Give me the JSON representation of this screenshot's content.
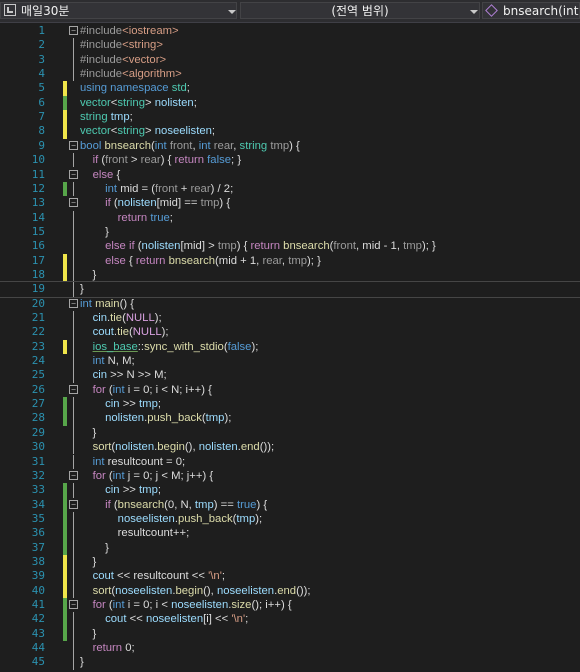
{
  "navbar": {
    "project": "매일30분",
    "scope": "(전역 범위)",
    "member": "bnsearch(int front, int rear, string tmp)"
  },
  "colors": {
    "change_saved": "#57a64a",
    "change_unsaved": "#efe54a"
  },
  "code": {
    "lines": [
      {
        "n": "1",
        "fold": "minus",
        "chg": "",
        "tokens": [
          [
            "p",
            "#include"
          ],
          [
            "s",
            "<iostream>"
          ]
        ]
      },
      {
        "n": "2",
        "fold": "bar",
        "chg": "",
        "tokens": [
          [
            "p",
            "#include"
          ],
          [
            "s",
            "<string>"
          ]
        ]
      },
      {
        "n": "3",
        "fold": "bar",
        "chg": "",
        "tokens": [
          [
            "p",
            "#include"
          ],
          [
            "s",
            "<vector>"
          ]
        ]
      },
      {
        "n": "4",
        "fold": "bar",
        "chg": "",
        "tokens": [
          [
            "p",
            "#include"
          ],
          [
            "s",
            "<algorithm>"
          ]
        ]
      },
      {
        "n": "5",
        "fold": "",
        "chg": "y",
        "tokens": [
          [
            "k",
            "using "
          ],
          [
            "k",
            "namespace "
          ],
          [
            "t",
            "std"
          ],
          [
            "w",
            ";"
          ]
        ]
      },
      {
        "n": "6",
        "fold": "",
        "chg": "g",
        "tokens": [
          [
            "t",
            "vector"
          ],
          [
            "w",
            "<"
          ],
          [
            "t",
            "string"
          ],
          [
            "w",
            "> "
          ],
          [
            "v",
            "nolisten"
          ],
          [
            "w",
            ";"
          ]
        ]
      },
      {
        "n": "7",
        "fold": "",
        "chg": "y",
        "tokens": [
          [
            "t",
            "string "
          ],
          [
            "v",
            "tmp"
          ],
          [
            "w",
            ";"
          ]
        ]
      },
      {
        "n": "8",
        "fold": "",
        "chg": "y",
        "tokens": [
          [
            "t",
            "vector"
          ],
          [
            "w",
            "<"
          ],
          [
            "t",
            "string"
          ],
          [
            "w",
            "> "
          ],
          [
            "v",
            "noseelisten"
          ],
          [
            "w",
            ";"
          ]
        ]
      },
      {
        "n": "9",
        "fold": "minus",
        "chg": "",
        "tokens": [
          [
            "k",
            "bool "
          ],
          [
            "f",
            "bnsearch"
          ],
          [
            "w",
            "("
          ],
          [
            "k",
            "int "
          ],
          [
            "p",
            "front"
          ],
          [
            "w",
            ", "
          ],
          [
            "k",
            "int "
          ],
          [
            "p",
            "rear"
          ],
          [
            "w",
            ", "
          ],
          [
            "t",
            "string "
          ],
          [
            "p",
            "tmp"
          ],
          [
            "w",
            ") {"
          ]
        ]
      },
      {
        "n": "10",
        "fold": "bar",
        "chg": "",
        "tokens": [
          [
            "w",
            "    "
          ],
          [
            "c",
            "if "
          ],
          [
            "w",
            "("
          ],
          [
            "p",
            "front"
          ],
          [
            "w",
            " > "
          ],
          [
            "p",
            "rear"
          ],
          [
            "w",
            ") { "
          ],
          [
            "c",
            "return "
          ],
          [
            "k",
            "false"
          ],
          [
            "w",
            "; }"
          ]
        ]
      },
      {
        "n": "11",
        "fold": "minus",
        "chg": "",
        "tokens": [
          [
            "w",
            "    "
          ],
          [
            "c",
            "else "
          ],
          [
            "w",
            "{"
          ]
        ]
      },
      {
        "n": "12",
        "fold": "bar",
        "chg": "g",
        "tokens": [
          [
            "w",
            "        "
          ],
          [
            "k",
            "int "
          ],
          [
            "w",
            "mid = ("
          ],
          [
            "p",
            "front"
          ],
          [
            "w",
            " + "
          ],
          [
            "p",
            "rear"
          ],
          [
            "w",
            ") / 2;"
          ]
        ]
      },
      {
        "n": "13",
        "fold": "minus",
        "chg": "",
        "tokens": [
          [
            "w",
            "        "
          ],
          [
            "c",
            "if "
          ],
          [
            "w",
            "("
          ],
          [
            "v",
            "nolisten"
          ],
          [
            "w",
            "[mid] == "
          ],
          [
            "p",
            "tmp"
          ],
          [
            "w",
            ") {"
          ]
        ]
      },
      {
        "n": "14",
        "fold": "bar",
        "chg": "",
        "tokens": [
          [
            "w",
            "            "
          ],
          [
            "c",
            "return "
          ],
          [
            "k",
            "true"
          ],
          [
            "w",
            ";"
          ]
        ]
      },
      {
        "n": "15",
        "fold": "bar",
        "chg": "",
        "tokens": [
          [
            "w",
            "        }"
          ]
        ]
      },
      {
        "n": "16",
        "fold": "bar",
        "chg": "",
        "tokens": [
          [
            "w",
            "        "
          ],
          [
            "c",
            "else if "
          ],
          [
            "w",
            "("
          ],
          [
            "v",
            "nolisten"
          ],
          [
            "w",
            "[mid] > "
          ],
          [
            "p",
            "tmp"
          ],
          [
            "w",
            ") { "
          ],
          [
            "c",
            "return "
          ],
          [
            "f",
            "bnsearch"
          ],
          [
            "w",
            "("
          ],
          [
            "p",
            "front"
          ],
          [
            "w",
            ", mid - 1, "
          ],
          [
            "p",
            "tmp"
          ],
          [
            "w",
            "); }"
          ]
        ]
      },
      {
        "n": "17",
        "fold": "bar",
        "chg": "y",
        "tokens": [
          [
            "w",
            "        "
          ],
          [
            "c",
            "else "
          ],
          [
            "w",
            "{ "
          ],
          [
            "c",
            "return "
          ],
          [
            "f",
            "bnsearch"
          ],
          [
            "w",
            "(mid + 1, "
          ],
          [
            "p",
            "rear"
          ],
          [
            "w",
            ", "
          ],
          [
            "p",
            "tmp"
          ],
          [
            "w",
            "); }"
          ]
        ]
      },
      {
        "n": "18",
        "fold": "bar",
        "chg": "y",
        "tokens": [
          [
            "w",
            "    }"
          ]
        ]
      },
      {
        "n": "19",
        "fold": "bar",
        "chg": "",
        "cursor": true,
        "tokens": [
          [
            "w",
            "}"
          ]
        ]
      },
      {
        "n": "20",
        "fold": "minus",
        "chg": "",
        "tokens": [
          [
            "k",
            "int "
          ],
          [
            "f",
            "main"
          ],
          [
            "w",
            "() {"
          ]
        ]
      },
      {
        "n": "21",
        "fold": "bar",
        "chg": "",
        "tokens": [
          [
            "w",
            "    "
          ],
          [
            "v",
            "cin"
          ],
          [
            "w",
            "."
          ],
          [
            "f",
            "tie"
          ],
          [
            "w",
            "("
          ],
          [
            "r",
            "NULL"
          ],
          [
            "w",
            ");"
          ]
        ]
      },
      {
        "n": "22",
        "fold": "bar",
        "chg": "",
        "tokens": [
          [
            "w",
            "    "
          ],
          [
            "v",
            "cout"
          ],
          [
            "w",
            "."
          ],
          [
            "f",
            "tie"
          ],
          [
            "w",
            "("
          ],
          [
            "r",
            "NULL"
          ],
          [
            "w",
            ");"
          ]
        ]
      },
      {
        "n": "23",
        "fold": "bar",
        "chg": "y",
        "tokens": [
          [
            "w",
            "    "
          ],
          [
            "g",
            "ios_base"
          ],
          [
            "w",
            "::"
          ],
          [
            "f",
            "sync_with_stdio"
          ],
          [
            "w",
            "("
          ],
          [
            "k",
            "false"
          ],
          [
            "w",
            ");"
          ]
        ]
      },
      {
        "n": "24",
        "fold": "bar",
        "chg": "",
        "tokens": [
          [
            "w",
            "    "
          ],
          [
            "k",
            "int "
          ],
          [
            "w",
            "N, M;"
          ]
        ]
      },
      {
        "n": "25",
        "fold": "bar",
        "chg": "",
        "tokens": [
          [
            "w",
            "    "
          ],
          [
            "v",
            "cin"
          ],
          [
            "w",
            " >> N >> M;"
          ]
        ]
      },
      {
        "n": "26",
        "fold": "minus",
        "chg": "",
        "tokens": [
          [
            "w",
            "    "
          ],
          [
            "c",
            "for "
          ],
          [
            "w",
            "("
          ],
          [
            "k",
            "int "
          ],
          [
            "w",
            "i = 0; i < N; i++) {"
          ]
        ]
      },
      {
        "n": "27",
        "fold": "bar",
        "chg": "g",
        "tokens": [
          [
            "w",
            "        "
          ],
          [
            "v",
            "cin"
          ],
          [
            "w",
            " >> "
          ],
          [
            "v",
            "tmp"
          ],
          [
            "w",
            ";"
          ]
        ]
      },
      {
        "n": "28",
        "fold": "bar",
        "chg": "g",
        "tokens": [
          [
            "w",
            "        "
          ],
          [
            "v",
            "nolisten"
          ],
          [
            "w",
            "."
          ],
          [
            "f",
            "push_back"
          ],
          [
            "w",
            "("
          ],
          [
            "v",
            "tmp"
          ],
          [
            "w",
            ");"
          ]
        ]
      },
      {
        "n": "29",
        "fold": "bar",
        "chg": "",
        "tokens": [
          [
            "w",
            "    }"
          ]
        ]
      },
      {
        "n": "30",
        "fold": "bar",
        "chg": "",
        "tokens": [
          [
            "w",
            "    "
          ],
          [
            "f",
            "sort"
          ],
          [
            "w",
            "("
          ],
          [
            "v",
            "nolisten"
          ],
          [
            "w",
            "."
          ],
          [
            "f",
            "begin"
          ],
          [
            "w",
            "(), "
          ],
          [
            "v",
            "nolisten"
          ],
          [
            "w",
            "."
          ],
          [
            "f",
            "end"
          ],
          [
            "w",
            "());"
          ]
        ]
      },
      {
        "n": "31",
        "fold": "bar",
        "chg": "",
        "tokens": [
          [
            "w",
            "    "
          ],
          [
            "k",
            "int "
          ],
          [
            "w",
            "resultcount = 0;"
          ]
        ]
      },
      {
        "n": "32",
        "fold": "minus",
        "chg": "",
        "tokens": [
          [
            "w",
            "    "
          ],
          [
            "c",
            "for "
          ],
          [
            "w",
            "("
          ],
          [
            "k",
            "int "
          ],
          [
            "w",
            "j = 0; j < M; j++) {"
          ]
        ]
      },
      {
        "n": "33",
        "fold": "bar",
        "chg": "g",
        "tokens": [
          [
            "w",
            "        "
          ],
          [
            "v",
            "cin"
          ],
          [
            "w",
            " >> "
          ],
          [
            "v",
            "tmp"
          ],
          [
            "w",
            ";"
          ]
        ]
      },
      {
        "n": "34",
        "fold": "minus",
        "chg": "g",
        "tokens": [
          [
            "w",
            "        "
          ],
          [
            "c",
            "if "
          ],
          [
            "w",
            "("
          ],
          [
            "f",
            "bnsearch"
          ],
          [
            "w",
            "(0, N, "
          ],
          [
            "v",
            "tmp"
          ],
          [
            "w",
            ") == "
          ],
          [
            "k",
            "true"
          ],
          [
            "w",
            ") {"
          ]
        ]
      },
      {
        "n": "35",
        "fold": "bar",
        "chg": "g",
        "tokens": [
          [
            "w",
            "            "
          ],
          [
            "v",
            "noseelisten"
          ],
          [
            "w",
            "."
          ],
          [
            "f",
            "push_back"
          ],
          [
            "w",
            "("
          ],
          [
            "v",
            "tmp"
          ],
          [
            "w",
            ");"
          ]
        ]
      },
      {
        "n": "36",
        "fold": "bar",
        "chg": "g",
        "tokens": [
          [
            "w",
            "            resultcount++;"
          ]
        ]
      },
      {
        "n": "37",
        "fold": "bar",
        "chg": "g",
        "tokens": [
          [
            "w",
            "        }"
          ]
        ]
      },
      {
        "n": "38",
        "fold": "bar",
        "chg": "y",
        "tokens": [
          [
            "w",
            "    }"
          ]
        ]
      },
      {
        "n": "39",
        "fold": "bar",
        "chg": "y",
        "tokens": [
          [
            "w",
            "    "
          ],
          [
            "v",
            "cout"
          ],
          [
            "w",
            " << resultcount << "
          ],
          [
            "s",
            "'\\n'"
          ],
          [
            "w",
            ";"
          ]
        ]
      },
      {
        "n": "40",
        "fold": "bar",
        "chg": "y",
        "tokens": [
          [
            "w",
            "    "
          ],
          [
            "f",
            "sort"
          ],
          [
            "w",
            "("
          ],
          [
            "v",
            "noseelisten"
          ],
          [
            "w",
            "."
          ],
          [
            "f",
            "begin"
          ],
          [
            "w",
            "(), "
          ],
          [
            "v",
            "noseelisten"
          ],
          [
            "w",
            "."
          ],
          [
            "f",
            "end"
          ],
          [
            "w",
            "());"
          ]
        ]
      },
      {
        "n": "41",
        "fold": "minus",
        "chg": "g",
        "tokens": [
          [
            "w",
            "    "
          ],
          [
            "c",
            "for "
          ],
          [
            "w",
            "("
          ],
          [
            "k",
            "int "
          ],
          [
            "w",
            "i = 0; i < "
          ],
          [
            "v",
            "noseelisten"
          ],
          [
            "w",
            "."
          ],
          [
            "f",
            "size"
          ],
          [
            "w",
            "(); i++) {"
          ]
        ]
      },
      {
        "n": "42",
        "fold": "bar",
        "chg": "g",
        "tokens": [
          [
            "w",
            "        "
          ],
          [
            "v",
            "cout"
          ],
          [
            "w",
            " << "
          ],
          [
            "v",
            "noseelisten"
          ],
          [
            "w",
            "[i] << "
          ],
          [
            "s",
            "'\\n'"
          ],
          [
            "w",
            ";"
          ]
        ]
      },
      {
        "n": "43",
        "fold": "bar",
        "chg": "g",
        "tokens": [
          [
            "w",
            "    }"
          ]
        ]
      },
      {
        "n": "44",
        "fold": "bar",
        "chg": "",
        "tokens": [
          [
            "w",
            "    "
          ],
          [
            "c",
            "return "
          ],
          [
            "w",
            "0;"
          ]
        ]
      },
      {
        "n": "45",
        "fold": "bar",
        "chg": "",
        "tokens": [
          [
            "w",
            "}"
          ]
        ]
      }
    ]
  }
}
